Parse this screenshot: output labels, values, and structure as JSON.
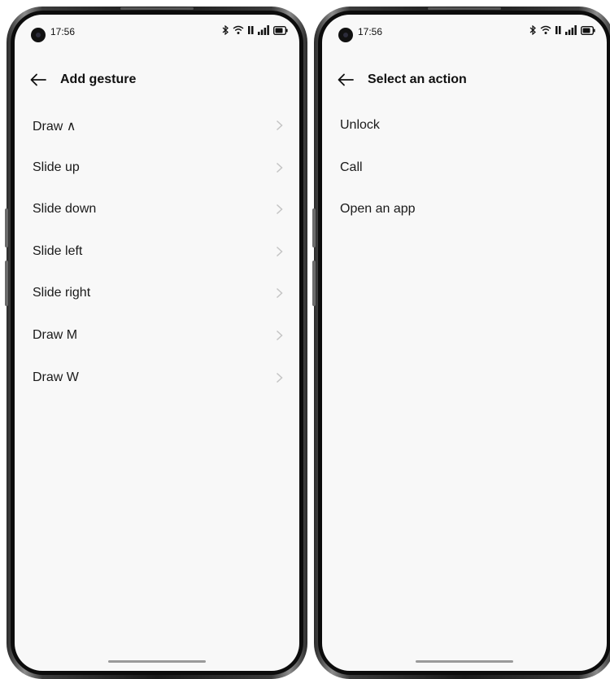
{
  "left_screen": {
    "status_bar": {
      "time": "17:56"
    },
    "app_bar": {
      "title": "Add gesture"
    },
    "gestures": [
      {
        "label": "Draw ∧"
      },
      {
        "label": "Slide up"
      },
      {
        "label": "Slide down"
      },
      {
        "label": "Slide left"
      },
      {
        "label": "Slide right"
      },
      {
        "label": "Draw M"
      },
      {
        "label": "Draw W"
      }
    ]
  },
  "right_screen": {
    "status_bar": {
      "time": "17:56"
    },
    "app_bar": {
      "title": "Select an action"
    },
    "actions": [
      {
        "label": "Unlock"
      },
      {
        "label": "Call"
      },
      {
        "label": "Open an app"
      }
    ]
  },
  "icons": {
    "back": "arrow-left-icon",
    "chevron": "chevron-right-icon",
    "bluetooth": "bluetooth-icon",
    "wifi": "wifi-icon",
    "data": "mobile-data-icon",
    "signal": "signal-bars-icon",
    "battery": "battery-icon"
  },
  "colors": {
    "screen_background": "#f8f8f8",
    "text": "#1a1a1a",
    "chevron": "#c4c4c4",
    "frame": "#1a1a1a"
  }
}
